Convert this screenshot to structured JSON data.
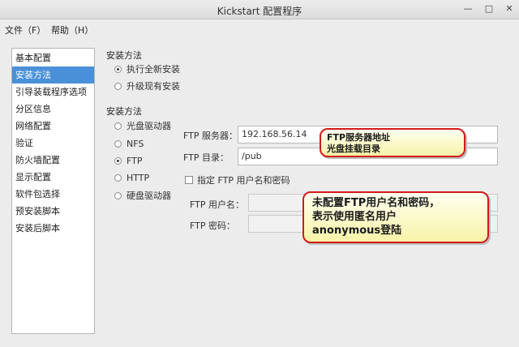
{
  "window": {
    "title": "Kickstart 配置程序",
    "min_icon": "minimize-icon",
    "max_icon": "maximize-icon",
    "close_icon": "close-icon"
  },
  "menu": {
    "file": "文件（F）",
    "help": "帮助（H）"
  },
  "sidebar": {
    "items": [
      {
        "label": "基本配置"
      },
      {
        "label": "安装方法"
      },
      {
        "label": "引导装载程序选项"
      },
      {
        "label": "分区信息"
      },
      {
        "label": "网络配置"
      },
      {
        "label": "验证"
      },
      {
        "label": "防火墙配置"
      },
      {
        "label": "显示配置"
      },
      {
        "label": "软件包选择"
      },
      {
        "label": "预安装脚本"
      },
      {
        "label": "安装后脚本"
      }
    ],
    "selected_index": 1
  },
  "install_method": {
    "heading": "安装方法",
    "options": [
      {
        "label": "执行全新安装",
        "selected": true
      },
      {
        "label": "升级现有安装",
        "selected": false
      }
    ]
  },
  "install_source": {
    "heading": "安装方法",
    "options": [
      {
        "label": "光盘驱动器",
        "selected": false
      },
      {
        "label": "NFS",
        "selected": false
      },
      {
        "label": "FTP",
        "selected": true
      },
      {
        "label": "HTTP",
        "selected": false
      },
      {
        "label": "硬盘驱动器",
        "selected": false
      }
    ]
  },
  "ftp": {
    "server_label": "FTP 服务器：",
    "server_value": "192.168.56.14",
    "dir_label": "FTP 目录：",
    "dir_value": "/pub",
    "auth_checkbox_label": "指定 FTP 用户名和密码",
    "auth_checked": false,
    "user_label": "FTP 用户名：",
    "user_value": "",
    "pass_label": "FTP 密码：",
    "pass_value": ""
  },
  "callouts": {
    "a_line1": "FTP服务器地址",
    "a_line2": "光盘挂载目录",
    "b_line1": "未配置FTP用户名和密码，",
    "b_line2": "表示使用匿名用户",
    "b_line3": "anonymous登陆"
  },
  "colors": {
    "selection": "#4a90d9",
    "callout_border": "#d21a1a",
    "callout_fill": "#fffbb8"
  }
}
